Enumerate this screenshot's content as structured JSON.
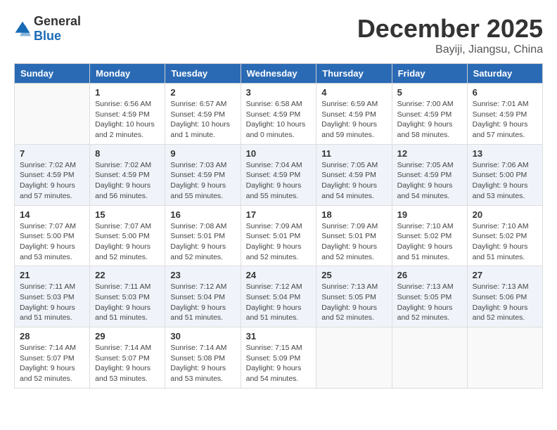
{
  "header": {
    "logo_general": "General",
    "logo_blue": "Blue",
    "month": "December 2025",
    "location": "Bayiji, Jiangsu, China"
  },
  "days_of_week": [
    "Sunday",
    "Monday",
    "Tuesday",
    "Wednesday",
    "Thursday",
    "Friday",
    "Saturday"
  ],
  "weeks": [
    [
      {
        "day": "",
        "info": ""
      },
      {
        "day": "1",
        "info": "Sunrise: 6:56 AM\nSunset: 4:59 PM\nDaylight: 10 hours\nand 2 minutes."
      },
      {
        "day": "2",
        "info": "Sunrise: 6:57 AM\nSunset: 4:59 PM\nDaylight: 10 hours\nand 1 minute."
      },
      {
        "day": "3",
        "info": "Sunrise: 6:58 AM\nSunset: 4:59 PM\nDaylight: 10 hours\nand 0 minutes."
      },
      {
        "day": "4",
        "info": "Sunrise: 6:59 AM\nSunset: 4:59 PM\nDaylight: 9 hours\nand 59 minutes."
      },
      {
        "day": "5",
        "info": "Sunrise: 7:00 AM\nSunset: 4:59 PM\nDaylight: 9 hours\nand 58 minutes."
      },
      {
        "day": "6",
        "info": "Sunrise: 7:01 AM\nSunset: 4:59 PM\nDaylight: 9 hours\nand 57 minutes."
      }
    ],
    [
      {
        "day": "7",
        "info": "Sunrise: 7:02 AM\nSunset: 4:59 PM\nDaylight: 9 hours\nand 57 minutes."
      },
      {
        "day": "8",
        "info": "Sunrise: 7:02 AM\nSunset: 4:59 PM\nDaylight: 9 hours\nand 56 minutes."
      },
      {
        "day": "9",
        "info": "Sunrise: 7:03 AM\nSunset: 4:59 PM\nDaylight: 9 hours\nand 55 minutes."
      },
      {
        "day": "10",
        "info": "Sunrise: 7:04 AM\nSunset: 4:59 PM\nDaylight: 9 hours\nand 55 minutes."
      },
      {
        "day": "11",
        "info": "Sunrise: 7:05 AM\nSunset: 4:59 PM\nDaylight: 9 hours\nand 54 minutes."
      },
      {
        "day": "12",
        "info": "Sunrise: 7:05 AM\nSunset: 4:59 PM\nDaylight: 9 hours\nand 54 minutes."
      },
      {
        "day": "13",
        "info": "Sunrise: 7:06 AM\nSunset: 5:00 PM\nDaylight: 9 hours\nand 53 minutes."
      }
    ],
    [
      {
        "day": "14",
        "info": "Sunrise: 7:07 AM\nSunset: 5:00 PM\nDaylight: 9 hours\nand 53 minutes."
      },
      {
        "day": "15",
        "info": "Sunrise: 7:07 AM\nSunset: 5:00 PM\nDaylight: 9 hours\nand 52 minutes."
      },
      {
        "day": "16",
        "info": "Sunrise: 7:08 AM\nSunset: 5:01 PM\nDaylight: 9 hours\nand 52 minutes."
      },
      {
        "day": "17",
        "info": "Sunrise: 7:09 AM\nSunset: 5:01 PM\nDaylight: 9 hours\nand 52 minutes."
      },
      {
        "day": "18",
        "info": "Sunrise: 7:09 AM\nSunset: 5:01 PM\nDaylight: 9 hours\nand 52 minutes."
      },
      {
        "day": "19",
        "info": "Sunrise: 7:10 AM\nSunset: 5:02 PM\nDaylight: 9 hours\nand 51 minutes."
      },
      {
        "day": "20",
        "info": "Sunrise: 7:10 AM\nSunset: 5:02 PM\nDaylight: 9 hours\nand 51 minutes."
      }
    ],
    [
      {
        "day": "21",
        "info": "Sunrise: 7:11 AM\nSunset: 5:03 PM\nDaylight: 9 hours\nand 51 minutes."
      },
      {
        "day": "22",
        "info": "Sunrise: 7:11 AM\nSunset: 5:03 PM\nDaylight: 9 hours\nand 51 minutes."
      },
      {
        "day": "23",
        "info": "Sunrise: 7:12 AM\nSunset: 5:04 PM\nDaylight: 9 hours\nand 51 minutes."
      },
      {
        "day": "24",
        "info": "Sunrise: 7:12 AM\nSunset: 5:04 PM\nDaylight: 9 hours\nand 51 minutes."
      },
      {
        "day": "25",
        "info": "Sunrise: 7:13 AM\nSunset: 5:05 PM\nDaylight: 9 hours\nand 52 minutes."
      },
      {
        "day": "26",
        "info": "Sunrise: 7:13 AM\nSunset: 5:05 PM\nDaylight: 9 hours\nand 52 minutes."
      },
      {
        "day": "27",
        "info": "Sunrise: 7:13 AM\nSunset: 5:06 PM\nDaylight: 9 hours\nand 52 minutes."
      }
    ],
    [
      {
        "day": "28",
        "info": "Sunrise: 7:14 AM\nSunset: 5:07 PM\nDaylight: 9 hours\nand 52 minutes."
      },
      {
        "day": "29",
        "info": "Sunrise: 7:14 AM\nSunset: 5:07 PM\nDaylight: 9 hours\nand 53 minutes."
      },
      {
        "day": "30",
        "info": "Sunrise: 7:14 AM\nSunset: 5:08 PM\nDaylight: 9 hours\nand 53 minutes."
      },
      {
        "day": "31",
        "info": "Sunrise: 7:15 AM\nSunset: 5:09 PM\nDaylight: 9 hours\nand 54 minutes."
      },
      {
        "day": "",
        "info": ""
      },
      {
        "day": "",
        "info": ""
      },
      {
        "day": "",
        "info": ""
      }
    ]
  ]
}
